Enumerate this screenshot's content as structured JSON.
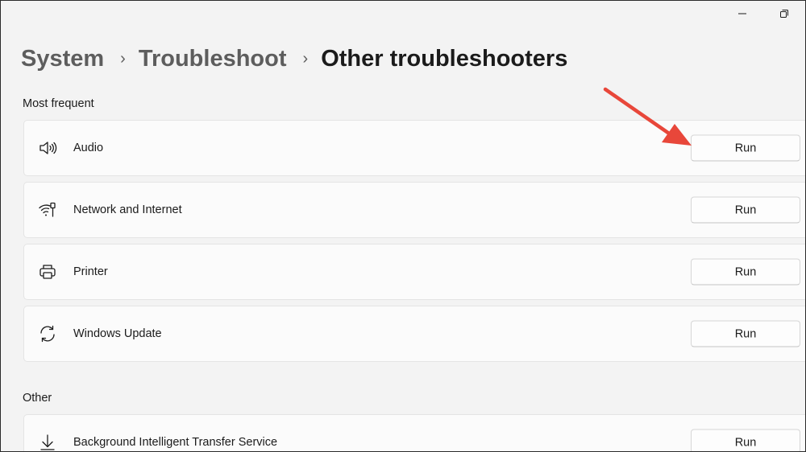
{
  "window": {
    "minimize_icon": "minimize-icon",
    "restore_icon": "restore-icon"
  },
  "breadcrumb": {
    "items": [
      "System",
      "Troubleshoot"
    ],
    "separator": "›",
    "current": "Other troubleshooters"
  },
  "sections": {
    "most_frequent": {
      "label": "Most frequent",
      "items": [
        {
          "label": "Audio",
          "icon": "speaker-icon",
          "button": "Run"
        },
        {
          "label": "Network and Internet",
          "icon": "wifi-network-icon",
          "button": "Run"
        },
        {
          "label": "Printer",
          "icon": "printer-icon",
          "button": "Run"
        },
        {
          "label": "Windows Update",
          "icon": "refresh-sync-icon",
          "button": "Run"
        }
      ]
    },
    "other": {
      "label": "Other",
      "items": [
        {
          "label": "Background Intelligent Transfer Service",
          "icon": "download-arrow-icon",
          "button": "Run"
        }
      ]
    }
  },
  "annotation": {
    "arrow_color": "#e8473a",
    "points_to": "audio-run-button"
  },
  "colors": {
    "background": "#f3f3f3",
    "card": "#fbfbfb",
    "text": "#1b1b1b",
    "breadcrumb_inactive": "#5d5d5d"
  }
}
